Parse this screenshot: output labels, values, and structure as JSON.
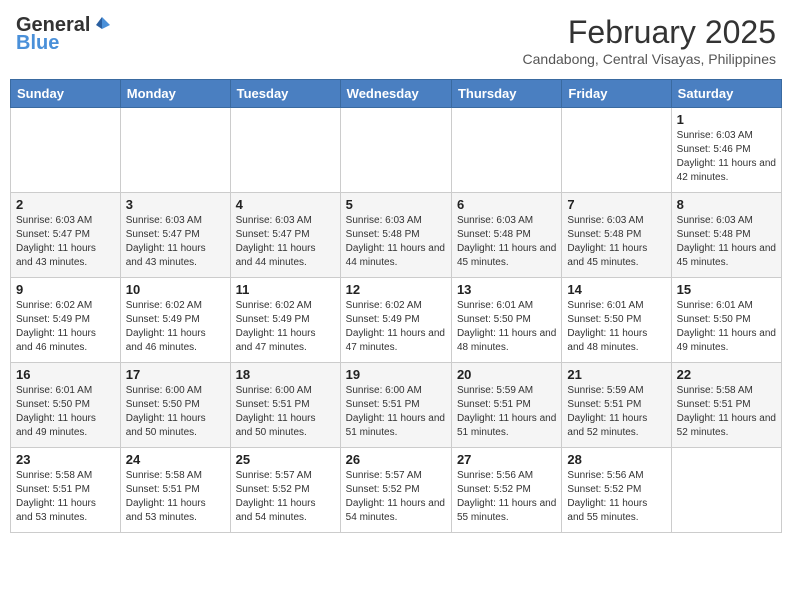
{
  "header": {
    "logo_general": "General",
    "logo_blue": "Blue",
    "month": "February 2025",
    "location": "Candabong, Central Visayas, Philippines"
  },
  "weekdays": [
    "Sunday",
    "Monday",
    "Tuesday",
    "Wednesday",
    "Thursday",
    "Friday",
    "Saturday"
  ],
  "weeks": [
    [
      {
        "day": "",
        "info": ""
      },
      {
        "day": "",
        "info": ""
      },
      {
        "day": "",
        "info": ""
      },
      {
        "day": "",
        "info": ""
      },
      {
        "day": "",
        "info": ""
      },
      {
        "day": "",
        "info": ""
      },
      {
        "day": "1",
        "info": "Sunrise: 6:03 AM\nSunset: 5:46 PM\nDaylight: 11 hours and 42 minutes."
      }
    ],
    [
      {
        "day": "2",
        "info": "Sunrise: 6:03 AM\nSunset: 5:47 PM\nDaylight: 11 hours and 43 minutes."
      },
      {
        "day": "3",
        "info": "Sunrise: 6:03 AM\nSunset: 5:47 PM\nDaylight: 11 hours and 43 minutes."
      },
      {
        "day": "4",
        "info": "Sunrise: 6:03 AM\nSunset: 5:47 PM\nDaylight: 11 hours and 44 minutes."
      },
      {
        "day": "5",
        "info": "Sunrise: 6:03 AM\nSunset: 5:48 PM\nDaylight: 11 hours and 44 minutes."
      },
      {
        "day": "6",
        "info": "Sunrise: 6:03 AM\nSunset: 5:48 PM\nDaylight: 11 hours and 45 minutes."
      },
      {
        "day": "7",
        "info": "Sunrise: 6:03 AM\nSunset: 5:48 PM\nDaylight: 11 hours and 45 minutes."
      },
      {
        "day": "8",
        "info": "Sunrise: 6:03 AM\nSunset: 5:48 PM\nDaylight: 11 hours and 45 minutes."
      }
    ],
    [
      {
        "day": "9",
        "info": "Sunrise: 6:02 AM\nSunset: 5:49 PM\nDaylight: 11 hours and 46 minutes."
      },
      {
        "day": "10",
        "info": "Sunrise: 6:02 AM\nSunset: 5:49 PM\nDaylight: 11 hours and 46 minutes."
      },
      {
        "day": "11",
        "info": "Sunrise: 6:02 AM\nSunset: 5:49 PM\nDaylight: 11 hours and 47 minutes."
      },
      {
        "day": "12",
        "info": "Sunrise: 6:02 AM\nSunset: 5:49 PM\nDaylight: 11 hours and 47 minutes."
      },
      {
        "day": "13",
        "info": "Sunrise: 6:01 AM\nSunset: 5:50 PM\nDaylight: 11 hours and 48 minutes."
      },
      {
        "day": "14",
        "info": "Sunrise: 6:01 AM\nSunset: 5:50 PM\nDaylight: 11 hours and 48 minutes."
      },
      {
        "day": "15",
        "info": "Sunrise: 6:01 AM\nSunset: 5:50 PM\nDaylight: 11 hours and 49 minutes."
      }
    ],
    [
      {
        "day": "16",
        "info": "Sunrise: 6:01 AM\nSunset: 5:50 PM\nDaylight: 11 hours and 49 minutes."
      },
      {
        "day": "17",
        "info": "Sunrise: 6:00 AM\nSunset: 5:50 PM\nDaylight: 11 hours and 50 minutes."
      },
      {
        "day": "18",
        "info": "Sunrise: 6:00 AM\nSunset: 5:51 PM\nDaylight: 11 hours and 50 minutes."
      },
      {
        "day": "19",
        "info": "Sunrise: 6:00 AM\nSunset: 5:51 PM\nDaylight: 11 hours and 51 minutes."
      },
      {
        "day": "20",
        "info": "Sunrise: 5:59 AM\nSunset: 5:51 PM\nDaylight: 11 hours and 51 minutes."
      },
      {
        "day": "21",
        "info": "Sunrise: 5:59 AM\nSunset: 5:51 PM\nDaylight: 11 hours and 52 minutes."
      },
      {
        "day": "22",
        "info": "Sunrise: 5:58 AM\nSunset: 5:51 PM\nDaylight: 11 hours and 52 minutes."
      }
    ],
    [
      {
        "day": "23",
        "info": "Sunrise: 5:58 AM\nSunset: 5:51 PM\nDaylight: 11 hours and 53 minutes."
      },
      {
        "day": "24",
        "info": "Sunrise: 5:58 AM\nSunset: 5:51 PM\nDaylight: 11 hours and 53 minutes."
      },
      {
        "day": "25",
        "info": "Sunrise: 5:57 AM\nSunset: 5:52 PM\nDaylight: 11 hours and 54 minutes."
      },
      {
        "day": "26",
        "info": "Sunrise: 5:57 AM\nSunset: 5:52 PM\nDaylight: 11 hours and 54 minutes."
      },
      {
        "day": "27",
        "info": "Sunrise: 5:56 AM\nSunset: 5:52 PM\nDaylight: 11 hours and 55 minutes."
      },
      {
        "day": "28",
        "info": "Sunrise: 5:56 AM\nSunset: 5:52 PM\nDaylight: 11 hours and 55 minutes."
      },
      {
        "day": "",
        "info": ""
      }
    ]
  ]
}
